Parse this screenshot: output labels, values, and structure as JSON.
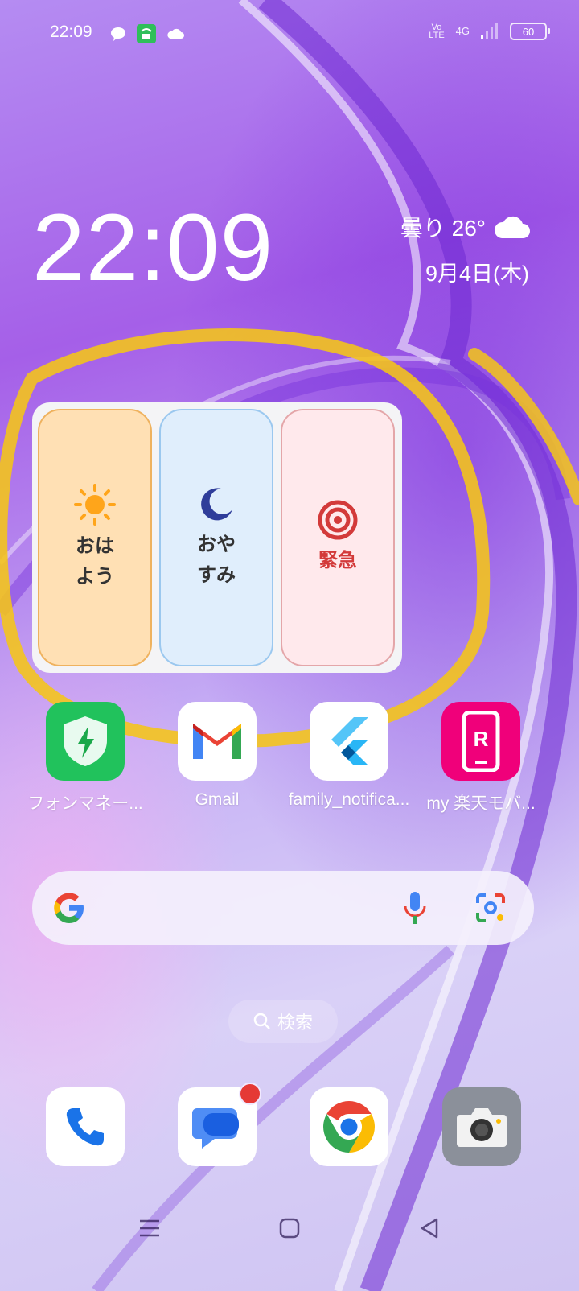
{
  "status_bar": {
    "time": "22:09",
    "volte_top": "Vo",
    "volte_bottom": "LTE",
    "network": "4G",
    "battery": "60"
  },
  "clock_widget": {
    "time": "22:09",
    "weather": "曇り 26°",
    "weather_icon": "cloud-icon",
    "date": "9月4日(木)"
  },
  "routine_widget": {
    "buttons": [
      {
        "label": "おはよう",
        "icon": "sun-icon",
        "accent": "#ffe0b4"
      },
      {
        "label": "おやすみ",
        "icon": "moon-icon",
        "accent": "#e0eefc"
      },
      {
        "label": "緊急",
        "icon": "target-icon",
        "accent": "#ffe9ec"
      }
    ]
  },
  "apps": [
    {
      "name": "フォンマネー...",
      "icon": "phone-manager-icon"
    },
    {
      "name": "Gmail",
      "icon": "gmail-icon"
    },
    {
      "name": "family_notifica...",
      "icon": "flutter-icon"
    },
    {
      "name": "my 楽天モバ...",
      "icon": "rakuten-mobile-icon"
    }
  ],
  "search": {
    "pill_label": "検索"
  },
  "dock": [
    {
      "icon": "phone-icon"
    },
    {
      "icon": "messages-icon",
      "has_badge": true
    },
    {
      "icon": "chrome-icon"
    },
    {
      "icon": "camera-icon"
    }
  ],
  "colors": {
    "highlight": "#f5c518",
    "emergency_text": "#d33a3a",
    "badge": "#e53935"
  }
}
